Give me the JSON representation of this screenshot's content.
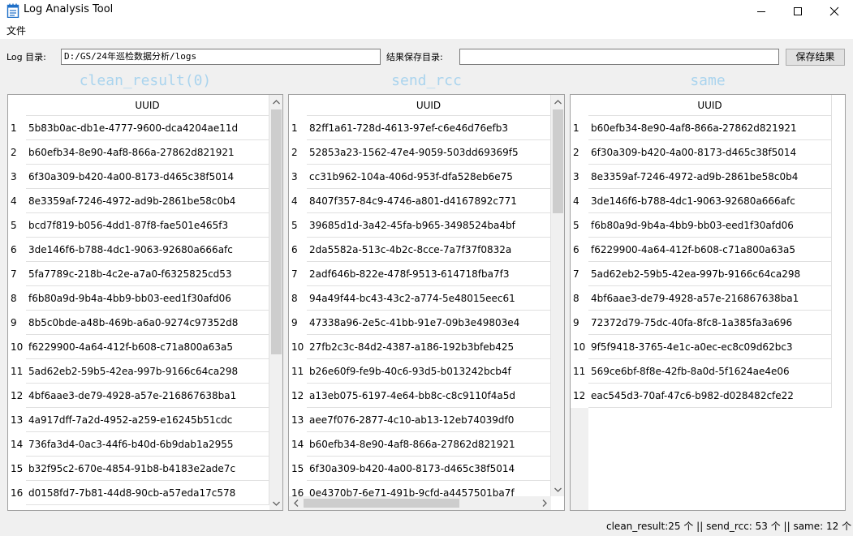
{
  "window": {
    "title": "Log Analysis Tool"
  },
  "menu": {
    "file": "文件"
  },
  "paths": {
    "log_label": "Log 目录:",
    "log_value": "D:/GS/24年巡检数据分析/logs",
    "save_label": "结果保存目录:",
    "save_value": "",
    "save_button": "保存结果"
  },
  "panels": {
    "clean": {
      "heading": "clean_result(0)",
      "column": "UUID",
      "rows": [
        "5b83b0ac-db1e-4777-9600-dca4204ae11d",
        "b60efb34-8e90-4af8-866a-27862d821921",
        "6f30a309-b420-4a00-8173-d465c38f5014",
        "8e3359af-7246-4972-ad9b-2861be58c0b4",
        "bcd7f819-b056-4dd1-87f8-fae501e465f3",
        "3de146f6-b788-4dc1-9063-92680a666afc",
        "5fa7789c-218b-4c2e-a7a0-f6325825cd53",
        "f6b80a9d-9b4a-4bb9-bb03-eed1f30afd06",
        "8b5c0bde-a48b-469b-a6a0-9274c97352d8",
        "f6229900-4a64-412f-b608-c71a800a63a5",
        "5ad62eb2-59b5-42ea-997b-9166c64ca298",
        "4bf6aae3-de79-4928-a57e-216867638ba1",
        "4a917dff-7a2d-4952-a259-e16245b51cdc",
        "736fa3d4-0ac3-44f6-b40d-6b9dab1a2955",
        "b32f95c2-670e-4854-91b8-b4183e2ade7c",
        "d0158fd7-7b81-44d8-90cb-a57eda17c578"
      ]
    },
    "rcc": {
      "heading": "send_rcc",
      "column": "UUID",
      "rows": [
        "82ff1a61-728d-4613-97ef-c6e46d76efb3",
        "52853a23-1562-47e4-9059-503dd69369f5",
        "cc31b962-104a-406d-953f-dfa528eb6e75",
        "8407f357-84c9-4746-a801-d4167892c771",
        "39685d1d-3a42-45fa-b965-3498524ba4bf",
        "2da5582a-513c-4b2c-8cce-7a7f37f0832a",
        "2adf646b-822e-478f-9513-614718fba7f3",
        "94a49f44-bc43-43c2-a774-5e48015eec61",
        "47338a96-2e5c-41bb-91e7-09b3e49803e4",
        "27fb2c3c-84d2-4387-a186-192b3bfeb425",
        "b26e60f9-fe9b-40c6-93d5-b013242bcb4f",
        "a13eb075-6197-4e64-bb8c-c8c9110f4a5d",
        "aee7f076-2877-4c10-ab13-12eb74039df0",
        "b60efb34-8e90-4af8-866a-27862d821921",
        "6f30a309-b420-4a00-8173-d465c38f5014",
        "0e4370b7-6e71-491b-9cfd-a4457501ba7f"
      ]
    },
    "same": {
      "heading": "same",
      "column": "UUID",
      "rows": [
        "b60efb34-8e90-4af8-866a-27862d821921",
        "6f30a309-b420-4a00-8173-d465c38f5014",
        "8e3359af-7246-4972-ad9b-2861be58c0b4",
        "3de146f6-b788-4dc1-9063-92680a666afc",
        "f6b80a9d-9b4a-4bb9-bb03-eed1f30afd06",
        "f6229900-4a64-412f-b608-c71a800a63a5",
        "5ad62eb2-59b5-42ea-997b-9166c64ca298",
        "4bf6aae3-de79-4928-a57e-216867638ba1",
        "72372d79-75dc-40fa-8fc8-1a385fa3a696",
        "9f5f9418-3765-4e1c-a0ec-ec8c09d62bc3",
        "569ce6bf-8f8e-42fb-8a0d-5f1624ae4e06",
        "eac545d3-70af-47c6-b982-d028482cfe22"
      ]
    }
  },
  "status": {
    "text": "clean_result:25 个 || send_rcc: 53 个 || same: 12 个"
  },
  "colors": {
    "heading": "#aad4ee",
    "titlebar": "#ffffff",
    "window_bg": "#f0f0f0",
    "scroll_thumb": "#cdcdcd"
  },
  "icons": {
    "app": "notepad-icon",
    "minimize": "minimize-icon",
    "maximize": "maximize-icon",
    "close": "close-icon",
    "scroll_up": "arrow-up-icon",
    "scroll_down": "arrow-down-icon",
    "scroll_left": "arrow-left-icon",
    "scroll_right": "arrow-right-icon"
  }
}
